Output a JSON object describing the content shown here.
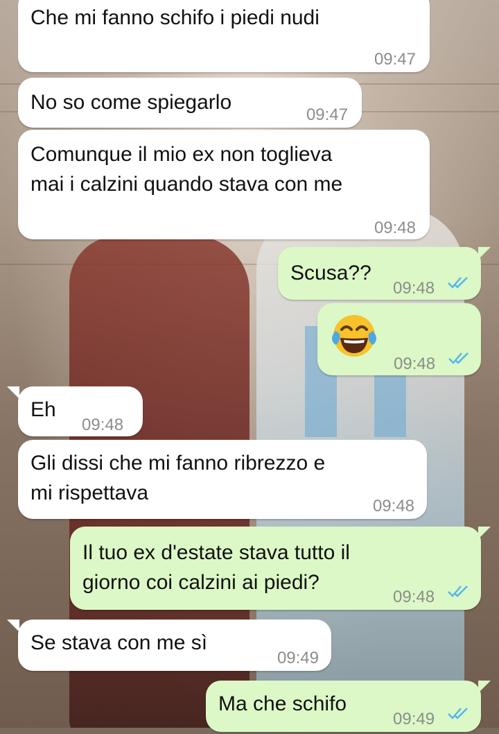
{
  "messages": [
    {
      "id": "m1",
      "direction": "incoming",
      "text": "Che mi fanno schifo i piedi nudi",
      "time": "09:47"
    },
    {
      "id": "m2",
      "direction": "incoming",
      "text": "No so come spiegarlo",
      "time": "09:47"
    },
    {
      "id": "m3",
      "direction": "incoming",
      "text": "Comunque il mio ex non toglieva\nmai i calzini quando stava con me",
      "time": "09:48"
    },
    {
      "id": "m4",
      "direction": "outgoing",
      "text": "Scusa??",
      "time": "09:48",
      "status": "read"
    },
    {
      "id": "m5",
      "direction": "outgoing",
      "emoji": "face-with-tears-of-joy",
      "time": "09:48",
      "status": "read"
    },
    {
      "id": "m6",
      "direction": "incoming",
      "text": "Eh",
      "time": "09:48"
    },
    {
      "id": "m7",
      "direction": "incoming",
      "text": "Gli dissi che mi fanno ribrezzo e\nmi rispettava",
      "time": "09:48"
    },
    {
      "id": "m8",
      "direction": "outgoing",
      "text": "Il tuo ex d'estate stava tutto il\ngiorno coi calzini ai piedi?",
      "time": "09:48",
      "status": "read"
    },
    {
      "id": "m9",
      "direction": "incoming",
      "text": "Se stava con me sì",
      "time": "09:49"
    },
    {
      "id": "m10",
      "direction": "outgoing",
      "text": "Ma che schifo",
      "time": "09:49",
      "status": "read"
    }
  ],
  "icons": {
    "read_receipt": "double-check-icon",
    "read_color": "#4fb6ec"
  },
  "colors": {
    "incoming_bubble": "#ffffff",
    "outgoing_bubble": "#dcf8c6",
    "timestamp": "#8c8c8c"
  }
}
